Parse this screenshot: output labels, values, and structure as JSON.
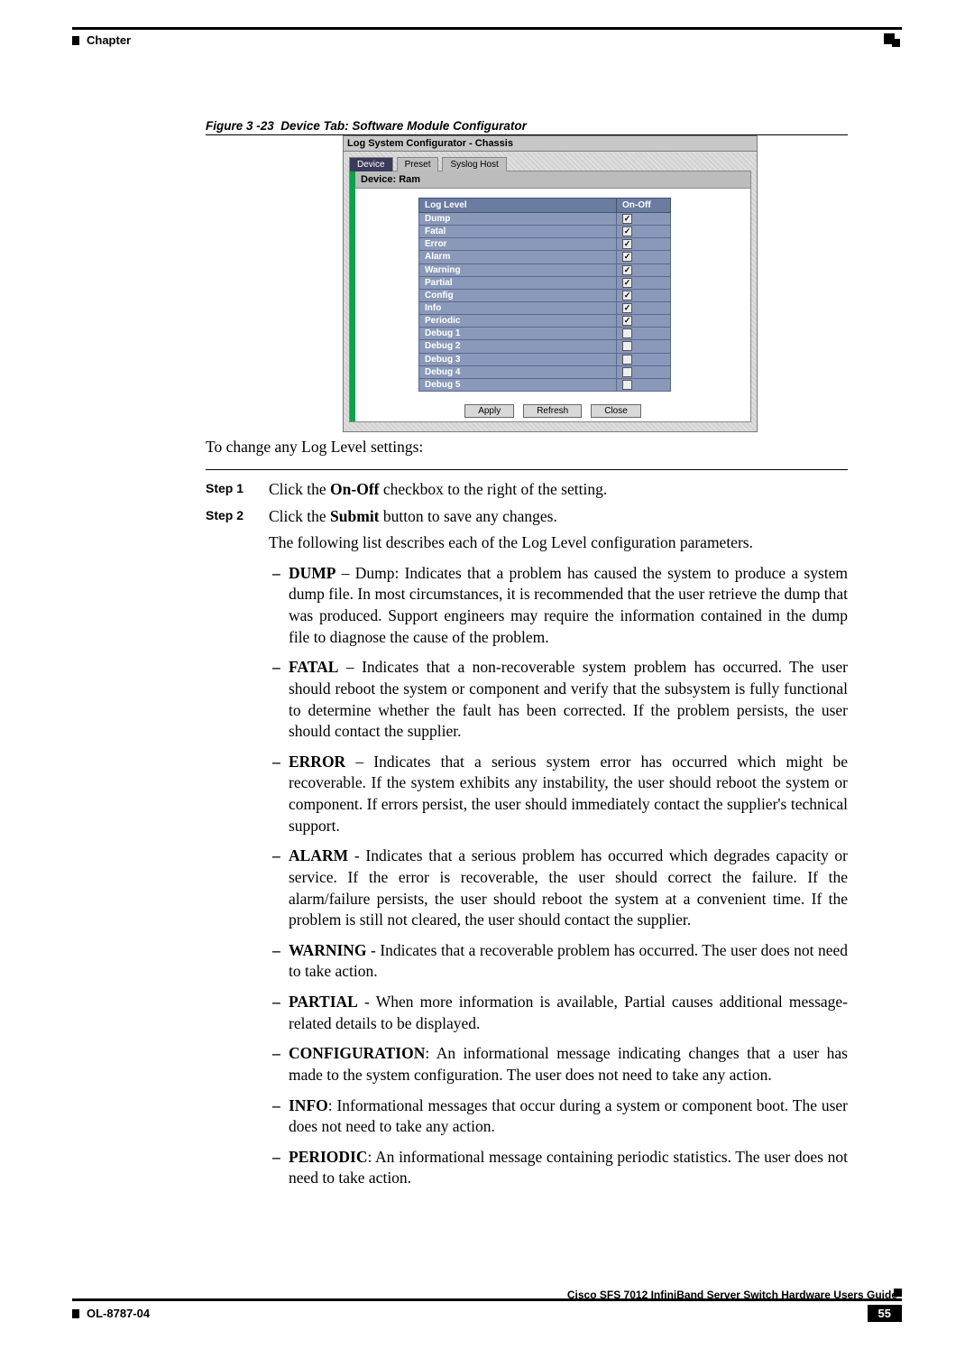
{
  "header": {
    "chapter_label": "Chapter"
  },
  "figure": {
    "caption_prefix": "Figure 3 -23",
    "caption_title": "Device Tab: Software Module Configurator"
  },
  "configurator": {
    "window_title": "Log System Configurator - Chassis",
    "tabs": {
      "device": "Device",
      "preset": "Preset",
      "syslog": "Syslog Host"
    },
    "device_label": "Device: Ram",
    "col_loglevel": "Log Level",
    "col_onoff": "On-Off",
    "rows": [
      {
        "label": "Dump",
        "checked": true
      },
      {
        "label": "Fatal",
        "checked": true
      },
      {
        "label": "Error",
        "checked": true
      },
      {
        "label": "Alarm",
        "checked": true
      },
      {
        "label": "Warning",
        "checked": true
      },
      {
        "label": "Partial",
        "checked": true
      },
      {
        "label": "Config",
        "checked": true
      },
      {
        "label": "Info",
        "checked": true
      },
      {
        "label": "Periodic",
        "checked": true
      },
      {
        "label": "Debug 1",
        "checked": false
      },
      {
        "label": "Debug 2",
        "checked": false
      },
      {
        "label": "Debug 3",
        "checked": false
      },
      {
        "label": "Debug 4",
        "checked": false
      },
      {
        "label": "Debug 5",
        "checked": false
      }
    ],
    "buttons": {
      "apply": "Apply",
      "refresh": "Refresh",
      "close": "Close"
    }
  },
  "body": {
    "intro": "To change any Log Level settings:",
    "step1_label": "Step 1",
    "step1_pre": "Click the ",
    "step1_bold": "On-Off",
    "step1_post": " checkbox to the right of the setting.",
    "step2_label": "Step 2",
    "step2_pre": "Click the ",
    "step2_bold": "Submit",
    "step2_post": " button to save any changes.",
    "step2_para": "The following list describes each of the Log Level configuration parameters.",
    "bullets": [
      {
        "term": "DUMP",
        "sep": " – ",
        "text": "Dump: Indicates that a problem has caused the system to produce a system dump file. In most circumstances, it is recommended that the user retrieve the dump that was produced. Support engineers may require the information contained in the dump file to diagnose the cause of the problem."
      },
      {
        "term": "FATAL",
        "sep": " – ",
        "text": "Indicates that a non-recoverable system problem has occurred. The user should reboot the system or component and verify that the subsystem is fully functional to determine whether the fault has been corrected. If the problem persists, the user should contact the supplier."
      },
      {
        "term": "ERROR",
        "sep": " – ",
        "text": "Indicates that a serious system error has occurred which might be recoverable. If the system exhibits any instability, the user should reboot the system or component. If errors persist, the user should immediately contact the supplier's technical support."
      },
      {
        "term": "ALARM",
        "sep": " - ",
        "text": "Indicates that a serious problem has occurred which degrades capacity or service. If the error is recoverable, the user should correct the failure. If the alarm/failure persists, the user should reboot the system at a convenient time. If the problem is still not cleared, the user should contact the supplier."
      },
      {
        "term": "WARNING",
        "sep": " - ",
        "text": "Indicates that a recoverable problem has occurred. The user does not need to take action."
      },
      {
        "term": "PARTIAL",
        "sep": " - ",
        "text": "When more information is available, Partial causes additional message-related details to be displayed."
      },
      {
        "term": "CONFIGURATION",
        "sep": ": ",
        "text": "An informational message indicating changes that a user has made to the system configuration. The user does not need to take any action."
      },
      {
        "term": "INFO",
        "sep": ": ",
        "text": "Informational messages that occur during a system or component boot. The user does not need to take any action."
      },
      {
        "term": "PERIODIC",
        "sep": ": ",
        "text": "An informational message containing periodic statistics. The user does not need to take action."
      }
    ]
  },
  "footer": {
    "doc_title": "Cisco SFS 7012 InfiniBand Server Switch Hardware Users Guide",
    "doc_id": "OL-8787-04",
    "page_no": "55"
  }
}
